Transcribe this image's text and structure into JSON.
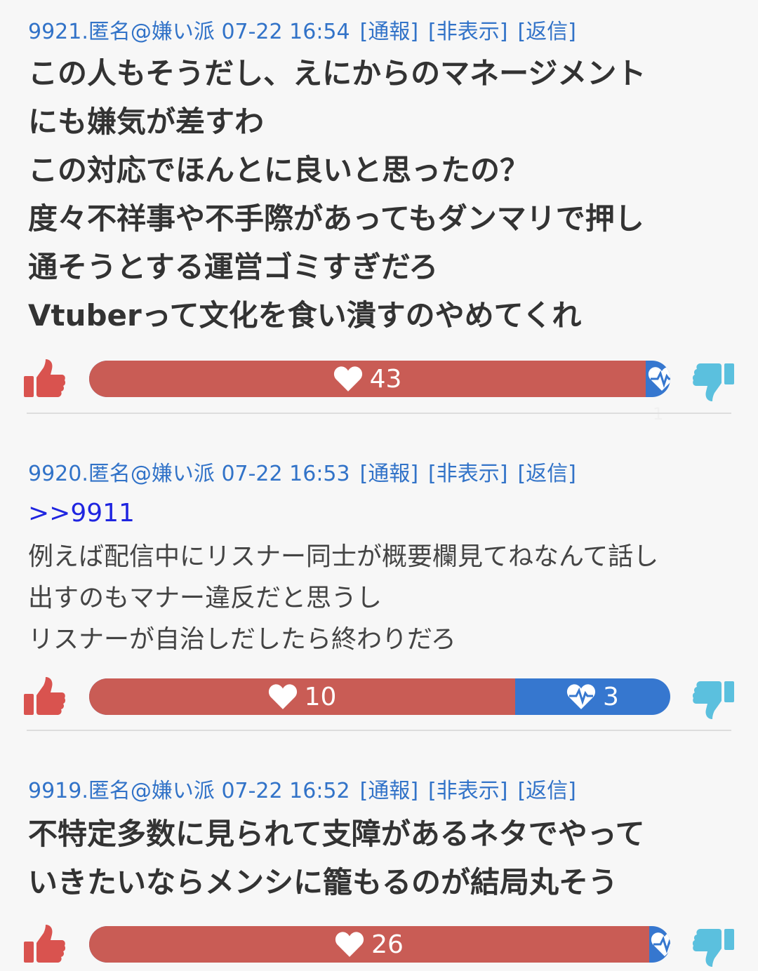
{
  "posts": [
    {
      "number": "9921.",
      "author": "匿名@嫌い派",
      "datetime": "07-22 16:54",
      "actions": {
        "report": "[通報]",
        "hide": "[非表示]",
        "reply": "[返信]"
      },
      "body": "この人もそうだし、えにからのマネージメント\nにも嫌気が差すわ\nこの対応でほんとに良いと思ったの？\n度々不祥事や不手際があってもダンマリで押し\n通そうとする運営ゴミすぎだろ\nVtuberって文化を食い潰すのやめてくれ",
      "likes": "43",
      "dislikes": "1"
    },
    {
      "number": "9920.",
      "author": "匿名@嫌い派",
      "datetime": "07-22 16:53",
      "actions": {
        "report": "[通報]",
        "hide": "[非表示]",
        "reply": "[返信]"
      },
      "reply_to": ">>9911",
      "body": "例えば配信中にリスナー同士が概要欄見てねなんて話し\n出すのもマナー違反だと思うし\nリスナーが自治しだしたら終わりだろ",
      "likes": "10",
      "dislikes": "3"
    },
    {
      "number": "9919.",
      "author": "匿名@嫌い派",
      "datetime": "07-22 16:52",
      "actions": {
        "report": "[通報]",
        "hide": "[非表示]",
        "reply": "[返信]"
      },
      "body": "不特定多数に見られて支障があるネタでやって\nいきたいならメンシに籠もるのが結局丸そう",
      "likes": "26",
      "dislikes": ""
    }
  ],
  "icons": {
    "like": "thumbs-up-icon",
    "dislike": "thumbs-down-icon",
    "like_count": "heart-icon",
    "dislike_count": "heartbeat-icon"
  },
  "colors": {
    "meta_link": "#3273c8",
    "reply_anchor": "#1f25e0",
    "like_bar": "#c95c55",
    "dislike_bar": "#3677cf",
    "thumb_up": "#d9534f",
    "thumb_down": "#5bc0de"
  }
}
